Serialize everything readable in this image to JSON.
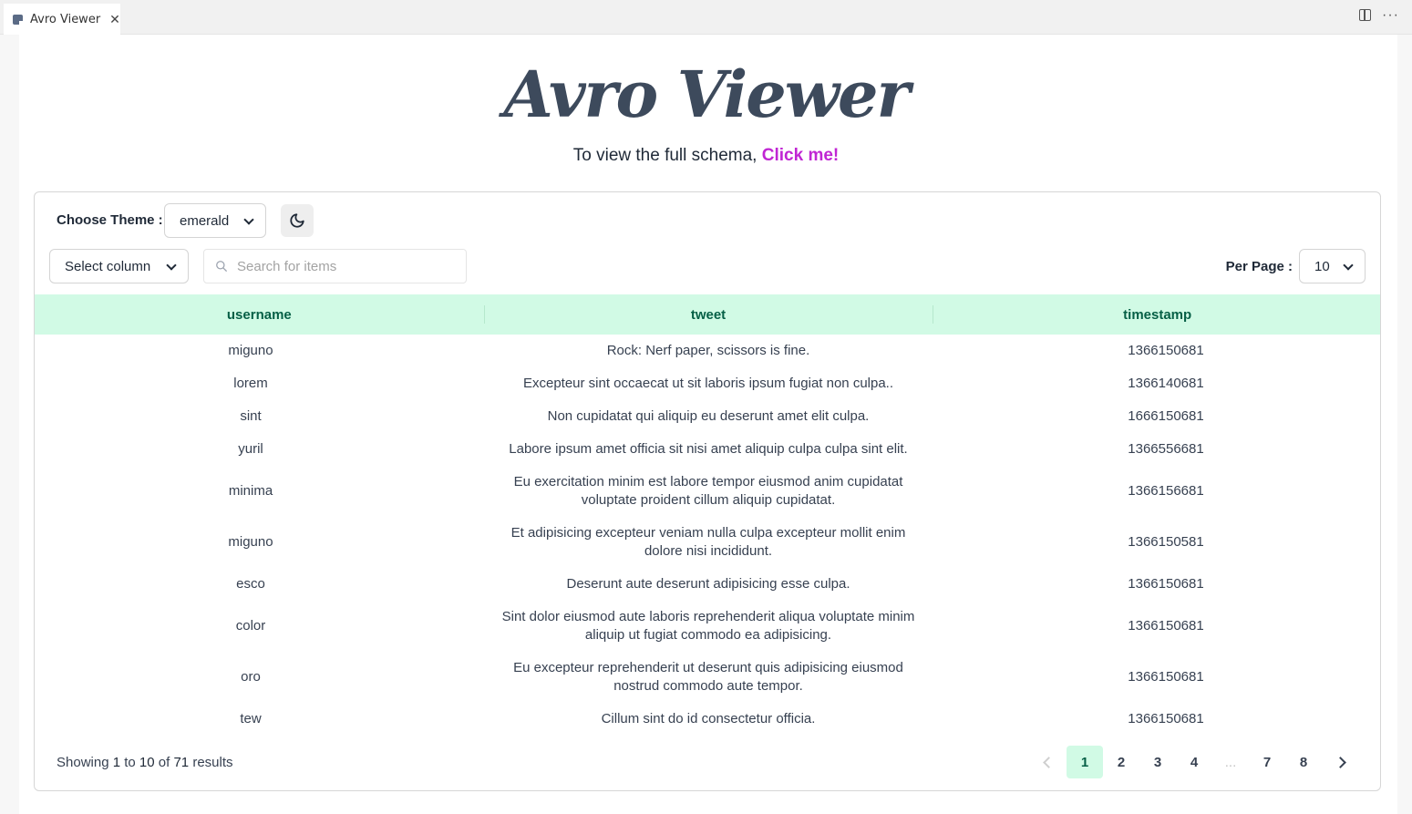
{
  "tab": {
    "title": "Avro Viewer",
    "close": "✕",
    "more": "···"
  },
  "header": {
    "title": "Avro Viewer",
    "subtitle_prefix": "To view the full schema, ",
    "subtitle_link": "Click me!"
  },
  "controls": {
    "theme_label": "Choose Theme :",
    "theme_value": "emerald",
    "column_select": "Select column",
    "search_placeholder": "Search for items",
    "per_page_label": "Per Page :",
    "per_page_value": "10"
  },
  "table": {
    "columns": [
      "username",
      "tweet",
      "timestamp"
    ],
    "rows": [
      [
        "miguno",
        "Rock: Nerf paper, scissors is fine.",
        "1366150681"
      ],
      [
        "lorem",
        "Excepteur sint occaecat ut sit laboris ipsum fugiat non culpa..",
        "1366140681"
      ],
      [
        "sint",
        "Non cupidatat qui aliquip eu deserunt amet elit culpa.",
        "1666150681"
      ],
      [
        "yuril",
        "Labore ipsum amet officia sit nisi amet aliquip culpa culpa sint elit.",
        "1366556681"
      ],
      [
        "minima",
        "Eu exercitation minim est labore tempor eiusmod anim cupidatat voluptate proident cillum aliquip cupidatat.",
        "1366156681"
      ],
      [
        "miguno",
        "Et adipisicing excepteur veniam nulla culpa excepteur mollit enim dolore nisi incididunt.",
        "1366150581"
      ],
      [
        "esco",
        "Deserunt aute deserunt adipisicing esse culpa.",
        "1366150681"
      ],
      [
        "color",
        "Sint dolor eiusmod aute laboris reprehenderit aliqua voluptate minim aliquip ut fugiat commodo ea adipisicing.",
        "1366150681"
      ],
      [
        "oro",
        "Eu excepteur reprehenderit ut deserunt quis adipisicing eiusmod nostrud commodo aute tempor.",
        "1366150681"
      ],
      [
        "tew",
        "Cillum sint do id consectetur officia.",
        "1366150681"
      ]
    ]
  },
  "footer": {
    "showing": "Showing",
    "from": "1",
    "to_word": "to",
    "to": "10",
    "of_word": "of",
    "total": "71",
    "results": "results",
    "pages": [
      "1",
      "2",
      "3",
      "4",
      "...",
      "7",
      "8"
    ],
    "current_page": "1"
  },
  "colors": {
    "accent": "#d1fae5",
    "accent_text": "#065f46",
    "link": "#c026d3",
    "title": "#3d4a5c"
  }
}
